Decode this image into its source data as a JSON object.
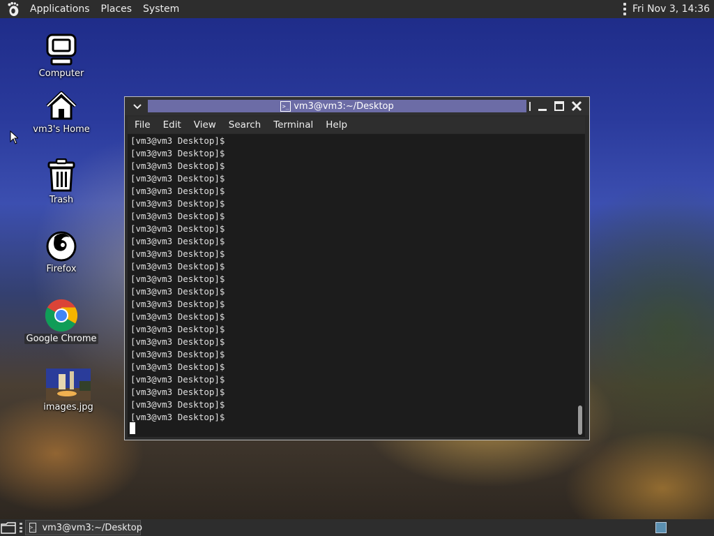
{
  "top_panel": {
    "menus": [
      "Applications",
      "Places",
      "System"
    ],
    "clock": "Fri Nov 3, 14:36"
  },
  "desktop_icons": [
    {
      "label": "Computer",
      "icon": "computer-icon"
    },
    {
      "label": "vm3's Home",
      "icon": "home-icon"
    },
    {
      "label": "Trash",
      "icon": "trash-icon"
    },
    {
      "label": "Firefox",
      "icon": "firefox-icon"
    },
    {
      "label": "Google Chrome",
      "icon": "chrome-icon"
    },
    {
      "label": "images.jpg",
      "icon": "image-file-icon"
    }
  ],
  "terminal": {
    "title": "vm3@vm3:~/Desktop",
    "menu": [
      "File",
      "Edit",
      "View",
      "Search",
      "Terminal",
      "Help"
    ],
    "prompt": "[vm3@vm3 Desktop]$",
    "prompt_line_count": 23
  },
  "bottom_panel": {
    "task_label": "vm3@vm3:~/Desktop"
  },
  "colors": {
    "panel": "#2d2d2d",
    "title_highlight": "#6c6ca6",
    "terminal_bg": "#1c1c1c"
  }
}
